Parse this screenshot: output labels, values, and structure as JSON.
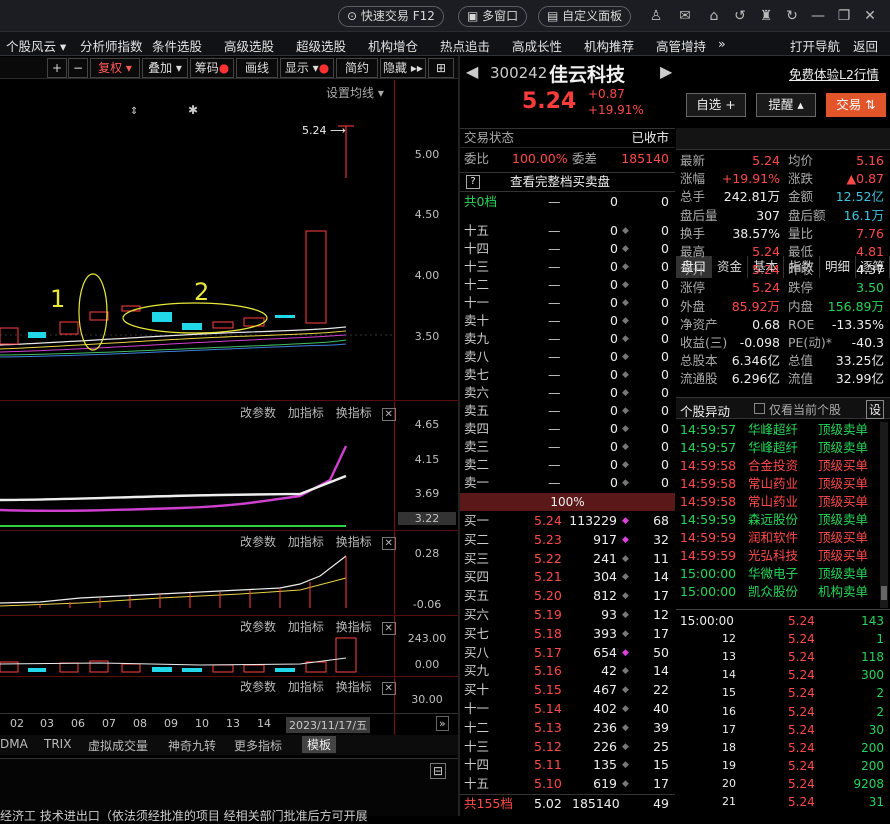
{
  "topbar": {
    "quick_trade": "快速交易 F12",
    "multi_window": "多窗口",
    "custom_panel": "自定义面板"
  },
  "menu": {
    "items": [
      "个股风云 ▾",
      "分析师指数",
      "条件选股",
      "高级选股",
      "超级选股",
      "机构增仓",
      "热点追击",
      "高成长性",
      "机构推荐",
      "高管增持"
    ],
    "more": "»",
    "open_nav": "打开导航",
    "back": "返回"
  },
  "chart_toolbar": {
    "plus": "+",
    "minus": "−",
    "adjust": "复权",
    "overlay": "叠加",
    "chips": "筹码",
    "draw": "画线",
    "display": "显示",
    "simple": "简约",
    "hide": "隐藏"
  },
  "chart": {
    "ma_settings": "设置均线",
    "price_marker": "5.24",
    "y_main": [
      "5.00",
      "4.50",
      "4.00",
      "3.50"
    ],
    "annotations": [
      "1",
      "2"
    ],
    "panel_buttons": {
      "params": "改参数",
      "add": "加指标",
      "switch": "换指标"
    },
    "y_ind1": [
      "4.65",
      "4.15",
      "3.69",
      "3.22"
    ],
    "y_ind2": [
      "0.28",
      "-0.06"
    ],
    "y_ind3": [
      "243.00",
      "0.00"
    ],
    "y_ind4": [
      "30.00"
    ],
    "dates": [
      "02",
      "03",
      "06",
      "07",
      "08",
      "09",
      "10",
      "13",
      "14"
    ],
    "date_current": "2023/11/17/五",
    "indicator_tabs": [
      "DMA",
      "TRIX",
      "虚拟成交量",
      "神奇九转",
      "更多指标",
      "模板"
    ],
    "bottom_text": "经济工 技术进出口（依法须经批准的项目 经相关部门批准后方可开展"
  },
  "quote": {
    "code": "300242",
    "name": "佳云科技",
    "price": "5.24",
    "change": "+0.87",
    "change_pct": "+19.91%",
    "promo": "免费体验L2行情",
    "btn_watch": "自选 +",
    "btn_alert": "提醒 ▴",
    "btn_trade": "交易 ⇅"
  },
  "orderbook": {
    "status_label": "交易状态",
    "status_value": "已收市",
    "ratio_label": "委比",
    "ratio_value": "100.00%",
    "diff_label": "委差",
    "diff_value": "185140",
    "help": "?",
    "full_book": "查看完整档买卖盘",
    "top_label": "共0档",
    "top_dash": "—",
    "top_vol": "0",
    "top_cnt": "0",
    "asks": [
      [
        "十五",
        "—",
        "0",
        "0"
      ],
      [
        "十四",
        "—",
        "0",
        "0"
      ],
      [
        "十三",
        "—",
        "0",
        "0"
      ],
      [
        "十二",
        "—",
        "0",
        "0"
      ],
      [
        "十一",
        "—",
        "0",
        "0"
      ],
      [
        "卖十",
        "—",
        "0",
        "0"
      ],
      [
        "卖九",
        "—",
        "0",
        "0"
      ],
      [
        "卖八",
        "—",
        "0",
        "0"
      ],
      [
        "卖七",
        "—",
        "0",
        "0"
      ],
      [
        "卖六",
        "—",
        "0",
        "0"
      ],
      [
        "卖五",
        "—",
        "0",
        "0"
      ],
      [
        "卖四",
        "—",
        "0",
        "0"
      ],
      [
        "卖三",
        "—",
        "0",
        "0"
      ],
      [
        "卖二",
        "—",
        "0",
        "0"
      ],
      [
        "卖一",
        "—",
        "0",
        "0"
      ]
    ],
    "pct": "100%",
    "bids": [
      [
        "买一",
        "5.24",
        "113229",
        "68"
      ],
      [
        "买二",
        "5.23",
        "917",
        "32"
      ],
      [
        "买三",
        "5.22",
        "241",
        "11"
      ],
      [
        "买四",
        "5.21",
        "304",
        "14"
      ],
      [
        "买五",
        "5.20",
        "812",
        "17"
      ],
      [
        "买六",
        "5.19",
        "93",
        "12"
      ],
      [
        "买七",
        "5.18",
        "393",
        "17"
      ],
      [
        "买八",
        "5.17",
        "654",
        "50"
      ],
      [
        "买九",
        "5.16",
        "42",
        "14"
      ],
      [
        "买十",
        "5.15",
        "467",
        "22"
      ],
      [
        "十一",
        "5.14",
        "402",
        "40"
      ],
      [
        "十二",
        "5.13",
        "236",
        "39"
      ],
      [
        "十三",
        "5.12",
        "226",
        "25"
      ],
      [
        "十四",
        "5.11",
        "135",
        "15"
      ],
      [
        "十五",
        "5.10",
        "619",
        "17"
      ]
    ],
    "total_label": "共155档",
    "total_price": "5.02",
    "total_vol": "185140",
    "total_cnt": "49"
  },
  "tabs": [
    "盘口",
    "资金",
    "基本",
    "指数",
    "明细",
    "逐笔"
  ],
  "stats": [
    [
      "最新",
      "5.24",
      "red",
      "均价",
      "5.16",
      "red"
    ],
    [
      "涨幅",
      "+19.91%",
      "red",
      "涨跌",
      "▲0.87",
      "red"
    ],
    [
      "总手",
      "242.81万",
      "white",
      "金额",
      "12.52亿",
      "cyan"
    ],
    [
      "盘后量",
      "307",
      "white",
      "盘后额",
      "16.1万",
      "cyan"
    ],
    [
      "换手",
      "38.57%",
      "white",
      "量比",
      "7.76",
      "red"
    ],
    [
      "最高",
      "5.24",
      "red",
      "最低",
      "4.81",
      "red"
    ],
    [
      "今开",
      "5.24",
      "red",
      "昨收",
      "4.37",
      "white"
    ],
    [
      "涨停",
      "5.24",
      "red",
      "跌停",
      "3.50",
      "green"
    ],
    [
      "外盘",
      "85.92万",
      "red",
      "内盘",
      "156.89万",
      "green"
    ],
    [
      "净资产",
      "0.68",
      "white",
      "ROE",
      "-13.35%",
      "white"
    ],
    [
      "收益(三)",
      "-0.098",
      "white",
      "PE(动)*",
      "-40.3",
      "white"
    ],
    [
      "总股本",
      "6.346亿",
      "white",
      "总值",
      "33.25亿",
      "white"
    ],
    [
      "流通股",
      "6.296亿",
      "white",
      "流值",
      "32.99亿",
      "white"
    ]
  ],
  "anomaly": {
    "title": "个股异动",
    "only_current": "仅看当前个股",
    "settings": "设",
    "rows": [
      [
        "14:59:57",
        "华峰超纤",
        "顶级卖单",
        "green"
      ],
      [
        "14:59:57",
        "华峰超纤",
        "顶级卖单",
        "green"
      ],
      [
        "14:59:58",
        "合金投资",
        "顶级买单",
        "red"
      ],
      [
        "14:59:58",
        "常山药业",
        "顶级买单",
        "red"
      ],
      [
        "14:59:58",
        "常山药业",
        "顶级买单",
        "red"
      ],
      [
        "14:59:59",
        "森远股份",
        "顶级卖单",
        "green"
      ],
      [
        "14:59:59",
        "润和软件",
        "顶级买单",
        "red"
      ],
      [
        "14:59:59",
        "光弘科技",
        "顶级买单",
        "red"
      ],
      [
        "15:00:00",
        "华微电子",
        "顶级卖单",
        "green"
      ],
      [
        "15:00:00",
        "凯众股份",
        "机构卖单",
        "green"
      ]
    ]
  },
  "trades": [
    [
      "15:00:00",
      "5.24",
      "143"
    ],
    [
      "12",
      "5.24",
      "1"
    ],
    [
      "13",
      "5.24",
      "118"
    ],
    [
      "14",
      "5.24",
      "300"
    ],
    [
      "15",
      "5.24",
      "2"
    ],
    [
      "16",
      "5.24",
      "2"
    ],
    [
      "17",
      "5.24",
      "30"
    ],
    [
      "18",
      "5.24",
      "200"
    ],
    [
      "19",
      "5.24",
      "200"
    ],
    [
      "20",
      "5.24",
      "9208"
    ],
    [
      "21",
      "5.24",
      "31"
    ]
  ]
}
